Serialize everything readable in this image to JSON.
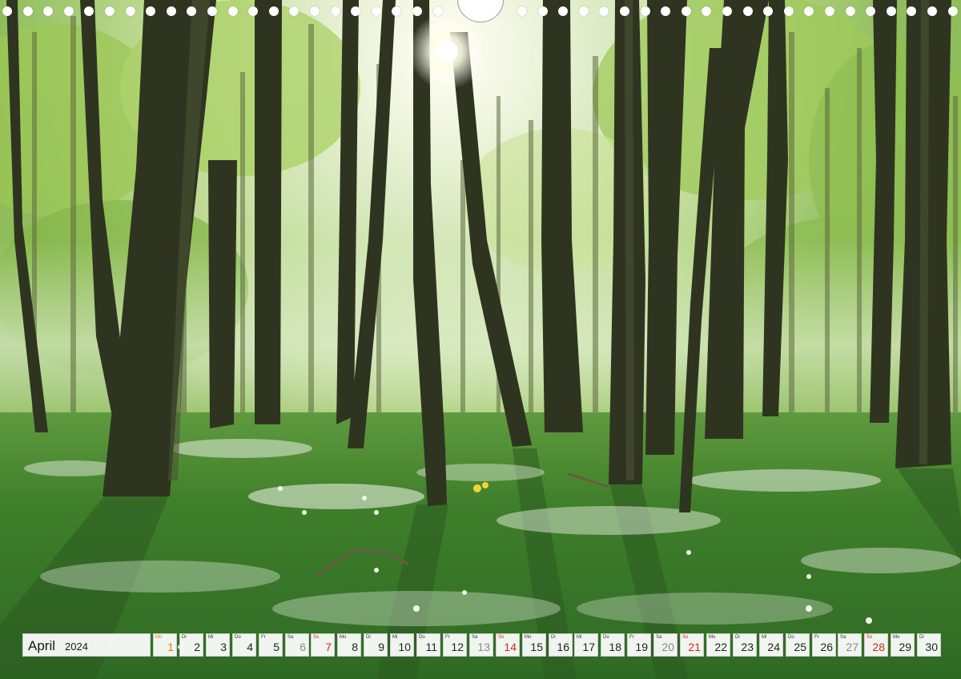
{
  "calendar": {
    "month": "April",
    "year": "2024",
    "days": [
      {
        "wd": "Mo",
        "day": "1",
        "type": "hol"
      },
      {
        "wd": "Di",
        "day": "2",
        "type": ""
      },
      {
        "wd": "Mi",
        "day": "3",
        "type": ""
      },
      {
        "wd": "Do",
        "day": "4",
        "type": ""
      },
      {
        "wd": "Fr",
        "day": "5",
        "type": ""
      },
      {
        "wd": "Sa",
        "day": "6",
        "type": "sat"
      },
      {
        "wd": "So",
        "day": "7",
        "type": "sun"
      },
      {
        "wd": "Mo",
        "day": "8",
        "type": ""
      },
      {
        "wd": "Di",
        "day": "9",
        "type": ""
      },
      {
        "wd": "Mi",
        "day": "10",
        "type": ""
      },
      {
        "wd": "Do",
        "day": "11",
        "type": ""
      },
      {
        "wd": "Fr",
        "day": "12",
        "type": ""
      },
      {
        "wd": "Sa",
        "day": "13",
        "type": "sat"
      },
      {
        "wd": "So",
        "day": "14",
        "type": "sun"
      },
      {
        "wd": "Mo",
        "day": "15",
        "type": ""
      },
      {
        "wd": "Di",
        "day": "16",
        "type": ""
      },
      {
        "wd": "Mi",
        "day": "17",
        "type": ""
      },
      {
        "wd": "Do",
        "day": "18",
        "type": ""
      },
      {
        "wd": "Fr",
        "day": "19",
        "type": ""
      },
      {
        "wd": "Sa",
        "day": "20",
        "type": "sat"
      },
      {
        "wd": "So",
        "day": "21",
        "type": "sun"
      },
      {
        "wd": "Mo",
        "day": "22",
        "type": ""
      },
      {
        "wd": "Di",
        "day": "23",
        "type": ""
      },
      {
        "wd": "Mi",
        "day": "24",
        "type": ""
      },
      {
        "wd": "Do",
        "day": "25",
        "type": ""
      },
      {
        "wd": "Fr",
        "day": "26",
        "type": ""
      },
      {
        "wd": "Sa",
        "day": "27",
        "type": "sat"
      },
      {
        "wd": "So",
        "day": "28",
        "type": "sun"
      },
      {
        "wd": "Mo",
        "day": "29",
        "type": ""
      },
      {
        "wd": "Di",
        "day": "30",
        "type": ""
      }
    ]
  },
  "colors": {
    "sunday": "#d8261f",
    "holiday": "#e27a1c",
    "saturday": "#8a8a8a",
    "cell_background": "#ffffff",
    "meadow": "#3f7f2a",
    "trunk": "#2f3421"
  }
}
